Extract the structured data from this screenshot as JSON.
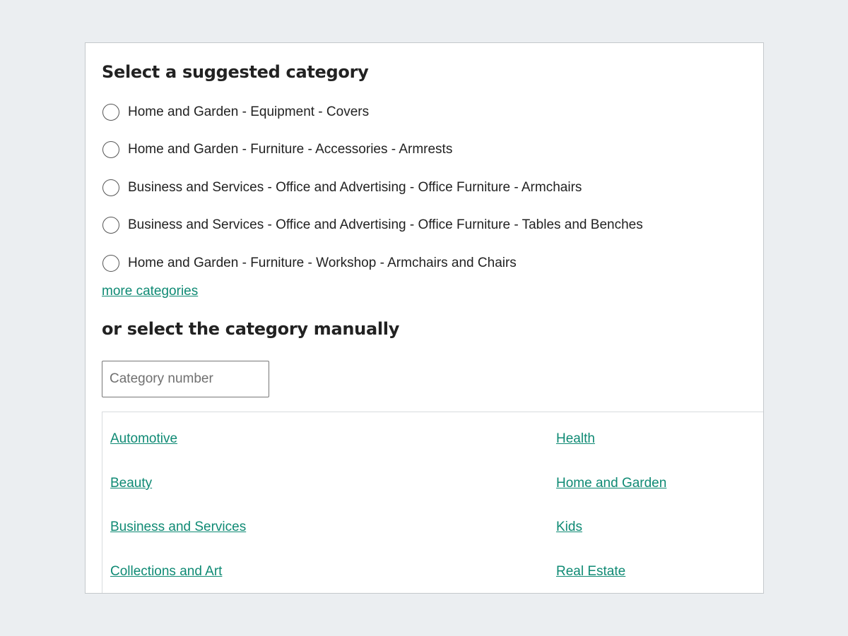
{
  "suggested": {
    "heading": "Select a suggested category",
    "options": [
      "Home and Garden - Equipment - Covers",
      "Home and Garden - Furniture - Accessories - Armrests",
      "Business and Services - Office and Advertising - Office Furniture - Armchairs",
      "Business and Services - Office and Advertising - Office Furniture - Tables and Benches",
      "Home and Garden - Furniture - Workshop - Armchairs and Chairs"
    ],
    "more_link": "more categories"
  },
  "manual": {
    "heading": "or select the category manually",
    "input_placeholder": "Category number",
    "input_value": "",
    "categories_left": [
      "Automotive",
      "Beauty",
      "Business and Services",
      "Collections and Art"
    ],
    "categories_right": [
      "Health",
      "Home and Garden",
      "Kids",
      "Real Estate"
    ]
  },
  "colors": {
    "link": "#0f8a74",
    "background": "#ebeef1",
    "panel": "#ffffff"
  }
}
